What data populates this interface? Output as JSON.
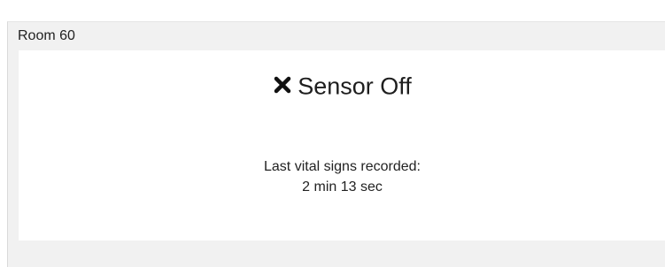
{
  "panel": {
    "room_title": "Room 60"
  },
  "status": {
    "icon": "close-icon",
    "text": "Sensor Off"
  },
  "vitals": {
    "label": "Last vital signs recorded:",
    "elapsed": "2 min 13 sec"
  }
}
